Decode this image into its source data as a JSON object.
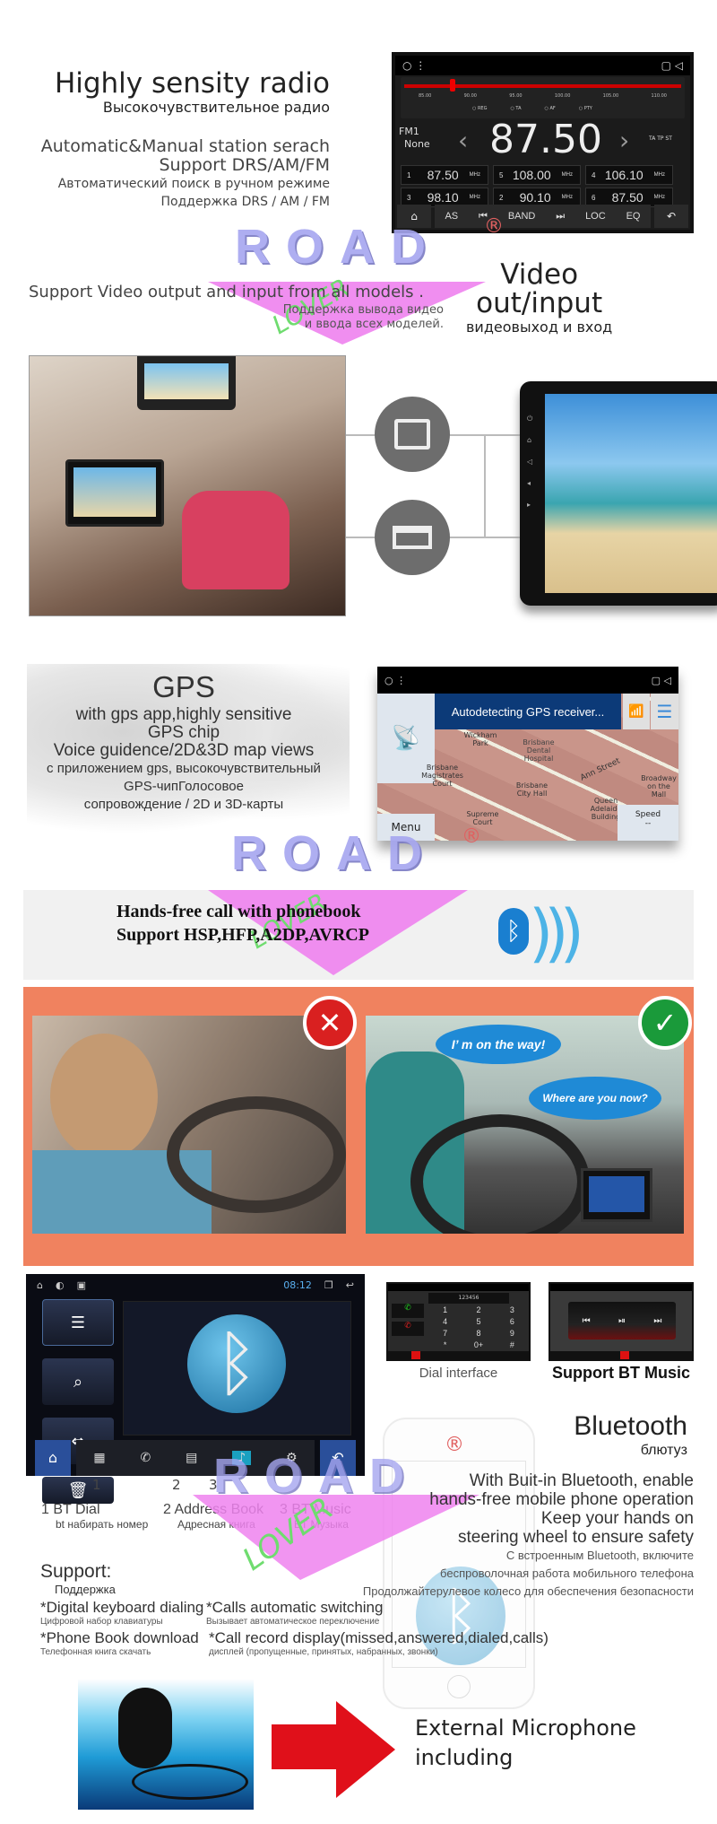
{
  "radio": {
    "title": "Highly sensity radio",
    "title_ru": "Высокочувствительное радио",
    "lines": [
      "Automatic&Manual station serach",
      "Support DRS/AM/FM"
    ],
    "lines_ru": [
      "Автоматический поиск в ручном режиме",
      "Поддержка DRS / AM / FM"
    ],
    "screen": {
      "scale": [
        "85.00",
        "90.00",
        "95.00",
        "100.00",
        "105.00",
        "110.00"
      ],
      "toggles": [
        "REG",
        "TA",
        "AF",
        "PTY"
      ],
      "band": "FM1",
      "station": "None",
      "frequency": "87.50",
      "flags": "TA TP ST",
      "unit": "MHz",
      "presets": [
        {
          "n": "1",
          "f": "87.50"
        },
        {
          "n": "3",
          "f": "98.10"
        },
        {
          "n": "5",
          "f": "108.00"
        },
        {
          "n": "2",
          "f": "90.10"
        },
        {
          "n": "4",
          "f": "106.10"
        },
        {
          "n": "6",
          "f": "87.50"
        }
      ],
      "buttons": [
        "AS",
        "BAND",
        "LOC",
        "EQ"
      ],
      "tuner_position_mhz": 87.5
    }
  },
  "brand": {
    "logo_text": "ROAD",
    "logo_sub": "LOVER",
    "registered": "®"
  },
  "video": {
    "text": "Support Video output and input from all models .",
    "text_ru": [
      "Поддержка вывода видео",
      "и ввода всех моделей."
    ],
    "title": [
      "Video",
      "out/input"
    ],
    "title_ru": "видеовыход и вход"
  },
  "gps": {
    "title": "GPS",
    "lines": [
      "with gps app,highly sensitive",
      "GPS chip",
      "Voice guidence/2D&3D map views"
    ],
    "lines_ru": [
      "с приложением gps, высокочувствительный",
      "GPS-чипГолосовое",
      "сопровождение / 2D и 3D-карты"
    ],
    "screen": {
      "banner": "Autodetecting GPS receiver...",
      "labels": [
        "Wickham Park",
        "Brisbane Dental Hospital",
        "Brisbane Magistrates Court",
        "Ann Street",
        "Brisbane City Hall",
        "Queen Adelaide Building",
        "Supreme Court",
        "Broadway on the Mall"
      ],
      "menu": "Menu",
      "speed_label": "Speed",
      "speed_value": "--"
    }
  },
  "handsfree": {
    "lines": [
      "Hands-free call with phonebook",
      "Support HSP,HFP,A2DP,AVRCP"
    ],
    "bubble1": "I’ m on the way!",
    "bubble2": "Where are you now?"
  },
  "bt_screen": {
    "time": "08:12",
    "numbers": [
      "1",
      "2",
      "3"
    ],
    "captions": [
      {
        "en": "1  BT Dial",
        "ru": "bt набирать номер"
      },
      {
        "en": "2  Address Book",
        "ru": "Адресная книга"
      },
      {
        "en": "3  BT Music",
        "ru": "BT Музыка"
      }
    ]
  },
  "dial": {
    "display": "123456",
    "keys": [
      "1",
      "2",
      "3",
      "4",
      "5",
      "6",
      "7",
      "8",
      "9",
      "*",
      "0+",
      "#"
    ],
    "caption": "Dial interface"
  },
  "music": {
    "caption": "Support BT Music"
  },
  "bluetooth": {
    "title": "Bluetooth",
    "title_ru": "блютуз",
    "lines": [
      "With Buit-in Bluetooth, enable",
      "hands-free mobile phone operation",
      "Keep your hands on",
      "steering wheel to ensure safety"
    ],
    "lines_ru": [
      "С встроенным Bluetooth, включите",
      "беспроволочная работа мобильного телефона",
      "Продолжайтерулевое колесо для обеспечения безопасности"
    ]
  },
  "support": {
    "title": "Support:",
    "title_ru": "Поддержка",
    "items": [
      {
        "en": "*Digital keyboard dialing",
        "ru": "Цифровой набор клавиатуры"
      },
      {
        "en": "*Calls automatic switching",
        "ru": "Вызывает автоматическое переключение"
      },
      {
        "en": "*Phone Book download",
        "ru": "Телефонная книга скачать"
      },
      {
        "en": "*Call record display(missed,answered,dialed,calls)",
        "ru": "дисплей (пропущенные, принятых, набранных, звонки)"
      }
    ]
  },
  "microphone": {
    "lines": [
      "External Microphone",
      "including"
    ]
  },
  "colors": {
    "orange_panel": "#f0825f",
    "logo": "#a6a6f0",
    "ribbon": "#ee82ee",
    "red_arrow": "#e0101a",
    "bubble": "#1f8ad6",
    "check": "#1a9a3a",
    "cross": "#d92020"
  }
}
